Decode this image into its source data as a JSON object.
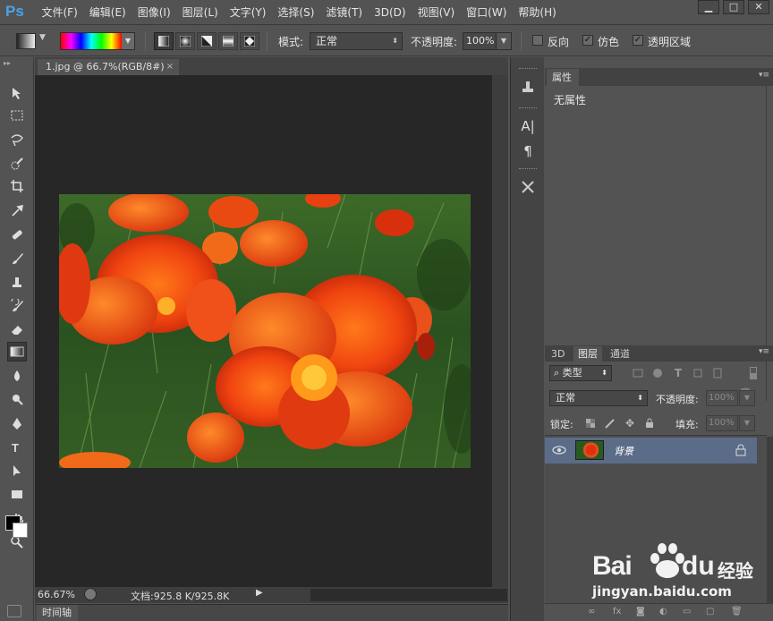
{
  "app": {
    "logo": "Ps",
    "menu": [
      "文件(F)",
      "编辑(E)",
      "图像(I)",
      "图层(L)",
      "文字(Y)",
      "选择(S)",
      "滤镜(T)",
      "3D(D)",
      "视图(V)",
      "窗口(W)",
      "帮助(H)"
    ],
    "window_controls": {
      "minimize": "▁",
      "maximize": "□",
      "close": "✕"
    }
  },
  "options_bar": {
    "mode_label": "模式:",
    "mode_value": "正常",
    "opacity_label": "不透明度:",
    "opacity_value": "100%",
    "reverse_label": "反向",
    "reverse_checked": false,
    "dither_label": "仿色",
    "dither_checked": true,
    "transparency_label": "透明区域",
    "transparency_checked": true,
    "gradient_types": [
      "linear",
      "radial",
      "angle",
      "reflected",
      "diamond"
    ],
    "active_gradient_type": "linear"
  },
  "toolbar": {
    "tools": [
      "move-tool",
      "marquee-tool",
      "lasso-tool",
      "quick-selection-tool",
      "crop-tool",
      "eyedropper-tool",
      "healing-brush-tool",
      "brush-tool",
      "clone-stamp-tool",
      "history-brush-tool",
      "eraser-tool",
      "gradient-tool",
      "blur-tool",
      "dodge-tool",
      "pen-tool",
      "type-tool",
      "path-selection-tool",
      "rectangle-tool",
      "hand-tool",
      "zoom-tool"
    ],
    "active_tool": "gradient-tool",
    "foreground_color": "#000000",
    "background_color": "#ffffff"
  },
  "document": {
    "tab_title": "1.jpg @ 66.7%(RGB/8#)",
    "tab_close": "×",
    "zoom": "66.67%",
    "doc_size": "文档:925.8 K/925.8K",
    "timeline_label": "时间轴"
  },
  "properties_panel": {
    "title": "属性",
    "empty_text": "无属性"
  },
  "layers_panel": {
    "tabs": [
      "3D",
      "图层",
      "通道"
    ],
    "active_tab": "图层",
    "filter_label": "类型",
    "blend_mode": "正常",
    "opacity_label": "不透明度:",
    "opacity_value": "100%",
    "lock_label": "锁定:",
    "fill_label": "填充:",
    "fill_value": "100%",
    "layers": [
      {
        "name": "背景",
        "visible": true,
        "locked": true,
        "selected": true
      }
    ],
    "selection_color": "#5a6c87"
  },
  "watermark": {
    "brand": "Bai",
    "brand2": "du",
    "product": "经验",
    "url": "jingyan.baidu.com"
  }
}
